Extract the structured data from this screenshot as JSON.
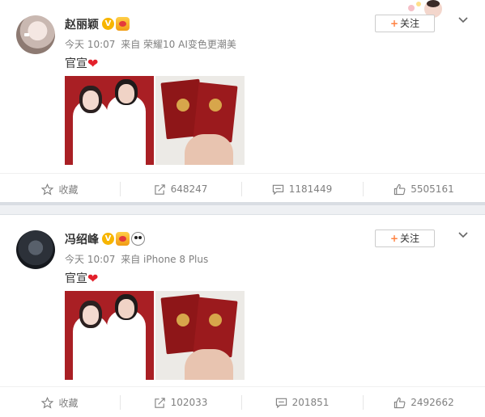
{
  "posts": [
    {
      "username": "赵丽颖",
      "verified_mark": "V",
      "time": "今天 10:07",
      "source": "来自 荣耀10 AI变色更潮美",
      "text": "官宣",
      "emoji": "❤",
      "follow_label": "关注",
      "follow_plus": "+",
      "actions": {
        "collect": "收藏",
        "repost": "648247",
        "comment": "1181449",
        "like": "5505161"
      }
    },
    {
      "username": "冯绍峰",
      "verified_mark": "V",
      "time": "今天 10:07",
      "source": "来自 iPhone 8 Plus",
      "text": "官宣",
      "emoji": "❤",
      "follow_label": "关注",
      "follow_plus": "+",
      "actions": {
        "collect": "收藏",
        "repost": "102033",
        "comment": "201851",
        "like": "2492662"
      }
    }
  ],
  "colors": {
    "accent_orange": "#ff8140",
    "heart_red": "#e3202b",
    "verified_gold": "#f7b500",
    "meta_gray": "#808080"
  },
  "icons": {
    "collect": "star-icon",
    "repost": "share-icon",
    "comment": "comment-icon",
    "like": "thumbs-up-icon",
    "menu": "chevron-down-icon"
  }
}
